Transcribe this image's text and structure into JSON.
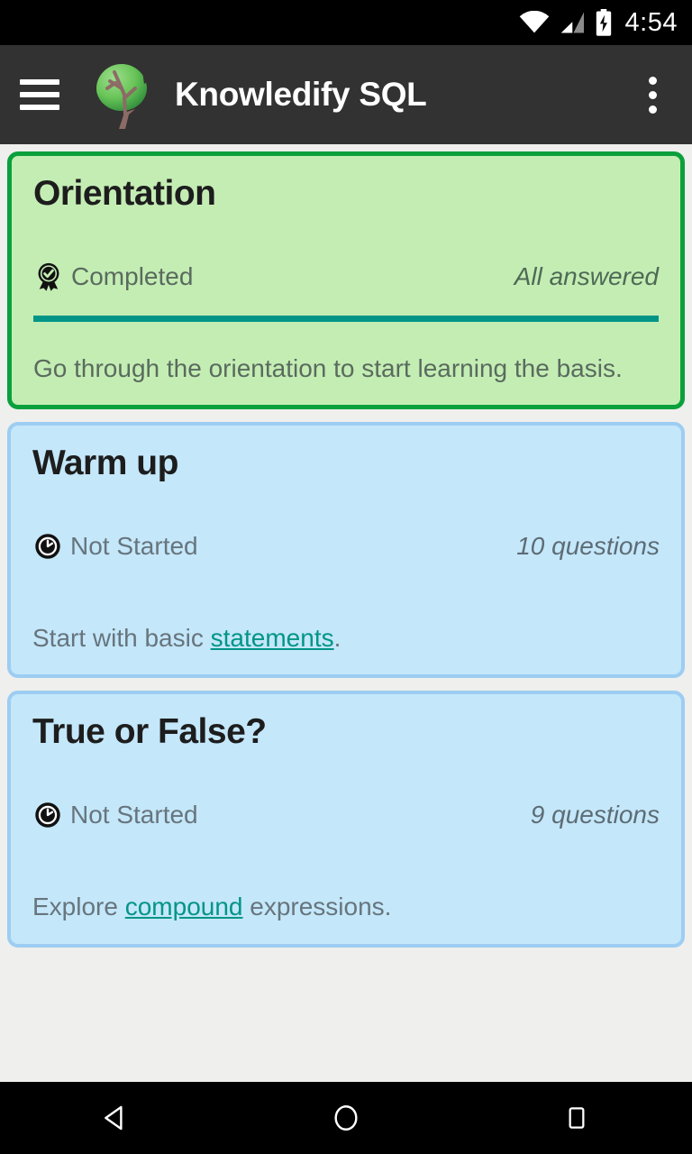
{
  "status_bar": {
    "time": "4:54",
    "icons": [
      "wifi-icon",
      "cell-signal-icon",
      "battery-charging-icon"
    ]
  },
  "toolbar": {
    "menu_icon": "hamburger-menu-icon",
    "logo_icon": "tree-logo-icon",
    "title": "Knowledify SQL",
    "overflow_icon": "overflow-menu-icon"
  },
  "cards": [
    {
      "title": "Orientation",
      "status_icon": "award-badge-icon",
      "status": "Completed",
      "count": "All answered",
      "progress": 100,
      "desc_prefix": "Go through the orientation to start learning the basis.",
      "link": "",
      "desc_suffix": "",
      "theme": "green"
    },
    {
      "title": "Warm up",
      "status_icon": "clock-icon",
      "status": "Not Started",
      "count": "10 questions",
      "progress": 0,
      "desc_prefix": "Start with basic ",
      "link": "statements",
      "desc_suffix": ".",
      "theme": "blue"
    },
    {
      "title": "True or False?",
      "status_icon": "clock-icon",
      "status": "Not Started",
      "count": "9 questions",
      "progress": 0,
      "desc_prefix": "Explore ",
      "link": "compound",
      "desc_suffix": " expressions.",
      "theme": "blue"
    }
  ],
  "nav_bar": {
    "back": "back-nav-icon",
    "home": "home-nav-icon",
    "recents": "recents-nav-icon"
  },
  "colors": {
    "green_card_bg": "#c4edb4",
    "green_card_border": "#0aa03c",
    "blue_card_bg": "#c4e7fa",
    "blue_card_border": "#9dcdf2",
    "accent_teal": "#019587",
    "toolbar_bg": "#323232",
    "page_bg": "#efefed"
  }
}
